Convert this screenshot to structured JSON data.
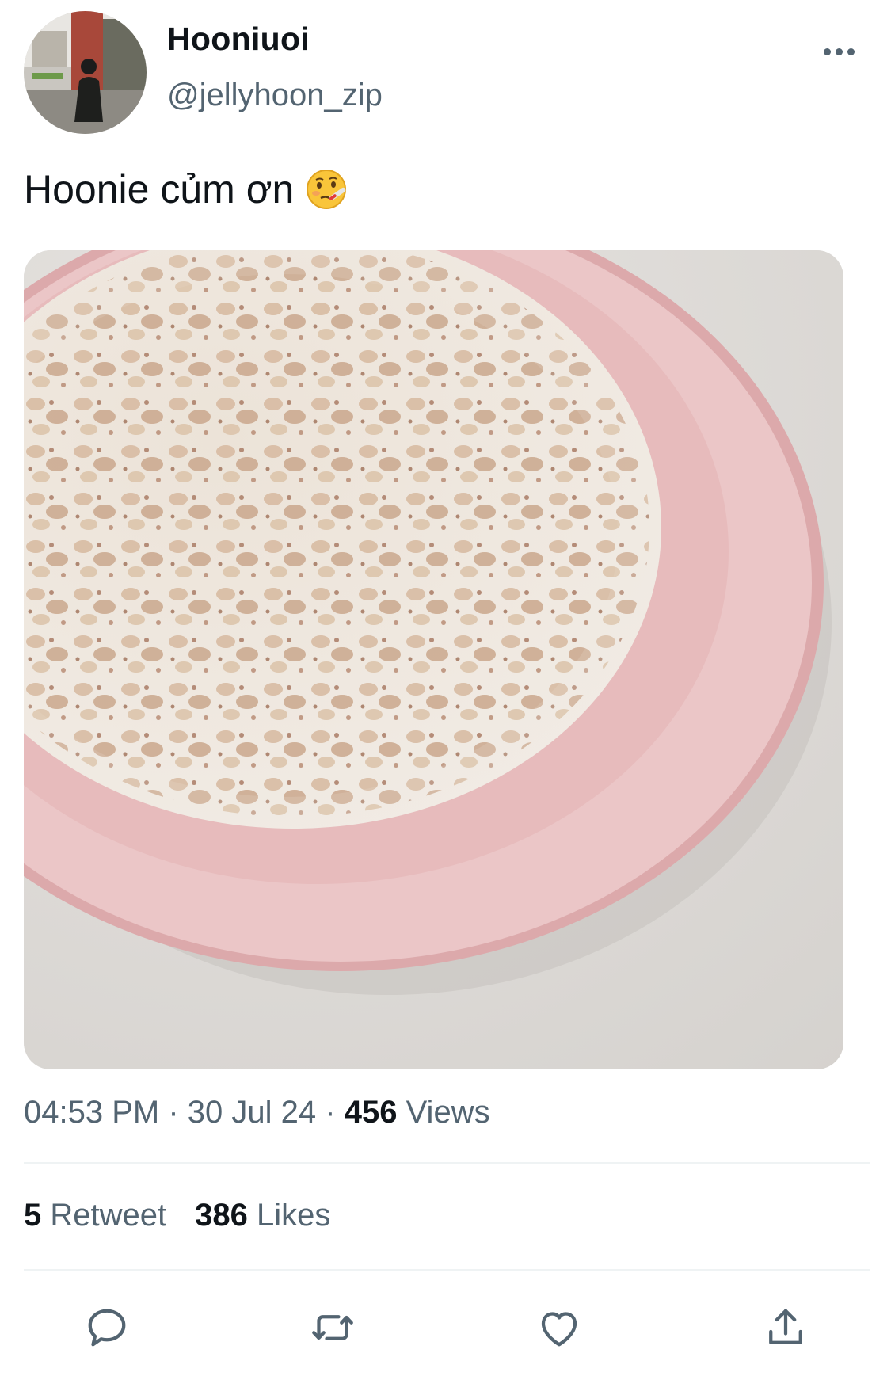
{
  "author": {
    "display_name": "Hooniuoi",
    "handle": "@jellyhoon_zip",
    "avatar_icon": "profile-photo"
  },
  "tweet": {
    "text": "Hoonie củm ơn",
    "emoji_icon": "face-with-thermometer-emoji",
    "media_icon": "oatmeal-bowl-photo"
  },
  "meta": {
    "time": "04:53 PM",
    "separator": "·",
    "date": "30 Jul 24",
    "views_count": "456",
    "views_label": "Views"
  },
  "stats": {
    "retweets_count": "5",
    "retweets_label": "Retweet",
    "likes_count": "386",
    "likes_label": "Likes"
  },
  "actions": {
    "reply_icon": "reply-icon",
    "retweet_icon": "retweet-icon",
    "like_icon": "heart-icon",
    "share_icon": "share-icon"
  },
  "colors": {
    "text_primary": "#0f1419",
    "text_secondary": "#536471",
    "divider": "#eff3f4",
    "bowl_pink": "#e8c3c3"
  }
}
